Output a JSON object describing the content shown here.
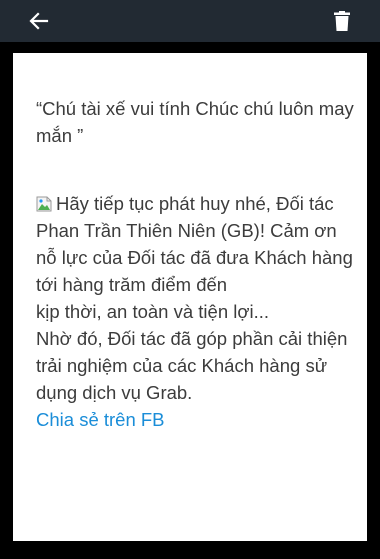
{
  "app_bar": {
    "background": "#222a33",
    "back_icon": "arrow-left-icon",
    "delete_icon": "trash-icon"
  },
  "card": {
    "quote": "“Chú tài xế vui tính Chúc chú luôn may mắn ”",
    "message_lines": [
      "Hãy tiếp tục phát huy nhé, Đối tác",
      "Phan Trần Thiên Niên (GB)! Cảm ơn nỗ lực của Đối tác đã đưa Khách hàng tới hàng trăm điểm đến",
      "kịp thời, an toàn và tiện lợi...",
      "Nhờ đó, Đối tác đã góp phần cải thiện trải nghiệm của các Khách hàng sử dụng dịch vụ Grab."
    ],
    "image_icon": "broken-image-icon",
    "share_link": "Chia sẻ trên FB",
    "link_color": "#1a8dd8"
  }
}
